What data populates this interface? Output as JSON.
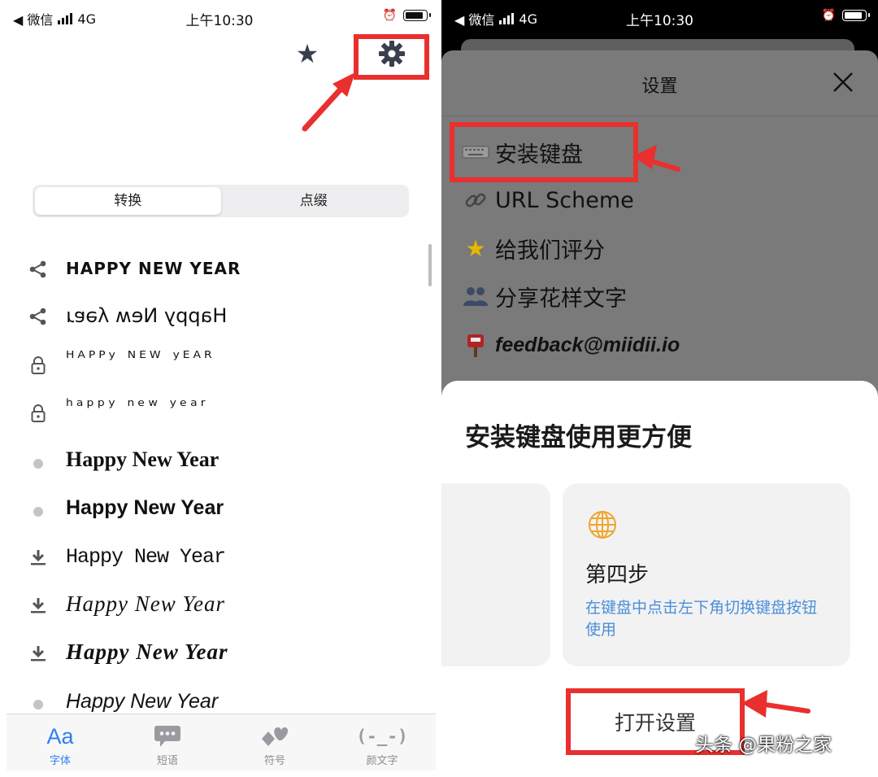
{
  "left": {
    "status": {
      "carrier": "◀ 微信",
      "network": "4G",
      "time": "上午10:30"
    },
    "segments": [
      "转换",
      "点缀"
    ],
    "font_rows": [
      {
        "icon": "share-icon",
        "text": "HAPPY NEW YEAR"
      },
      {
        "icon": "share-icon",
        "text": "Happy Neʍ ʎǝɐɹ"
      },
      {
        "icon": "lock-icon",
        "text": "ᴴᴬᴾᴾʸ ᴺᴱᵂ ʸᴱᴬᴿ"
      },
      {
        "icon": "lock-icon",
        "text": "ʰᵃᵖᵖʸ ⁿᵉʷ ʸᵉᵃʳ"
      },
      {
        "icon": "dot-icon",
        "text": "Happy New Year"
      },
      {
        "icon": "dot-icon",
        "text": "Happy New Year"
      },
      {
        "icon": "download-icon",
        "text": "Happy New Year"
      },
      {
        "icon": "download-icon",
        "text": "Happy New Year"
      },
      {
        "icon": "download-icon",
        "text": "Happy New Year"
      },
      {
        "icon": "dot-icon",
        "text": "Happy New Year"
      }
    ],
    "tabs": [
      {
        "label": "字体",
        "icon": "Aa"
      },
      {
        "label": "短语",
        "icon": "speech-bubble-icon"
      },
      {
        "label": "符号",
        "icon": "symbols-icon"
      },
      {
        "label": "颜文字",
        "icon": "(-_-)"
      }
    ],
    "tab_active_color": "#2f7ef5"
  },
  "right": {
    "status": {
      "carrier": "◀ 微信",
      "network": "4G",
      "time": "上午10:30"
    },
    "sheet_title": "设置",
    "menu": [
      {
        "icon": "keyboard-icon",
        "label": "安装键盘"
      },
      {
        "icon": "link-icon",
        "label": "URL Scheme"
      },
      {
        "icon": "star-icon",
        "label": "给我们评分"
      },
      {
        "icon": "people-icon",
        "label": "分享花样文字"
      },
      {
        "icon": "mailbox-icon",
        "label": "feedback@miidii.io"
      }
    ],
    "modal": {
      "title": "安装键盘使用更方便",
      "step_title": "第四步",
      "step_desc": "在键盘中点击左下角切换键盘按钮使用",
      "button": "打开设置"
    }
  },
  "watermark": "头条 @果粉之家",
  "highlight_color": "#ea2f2f"
}
